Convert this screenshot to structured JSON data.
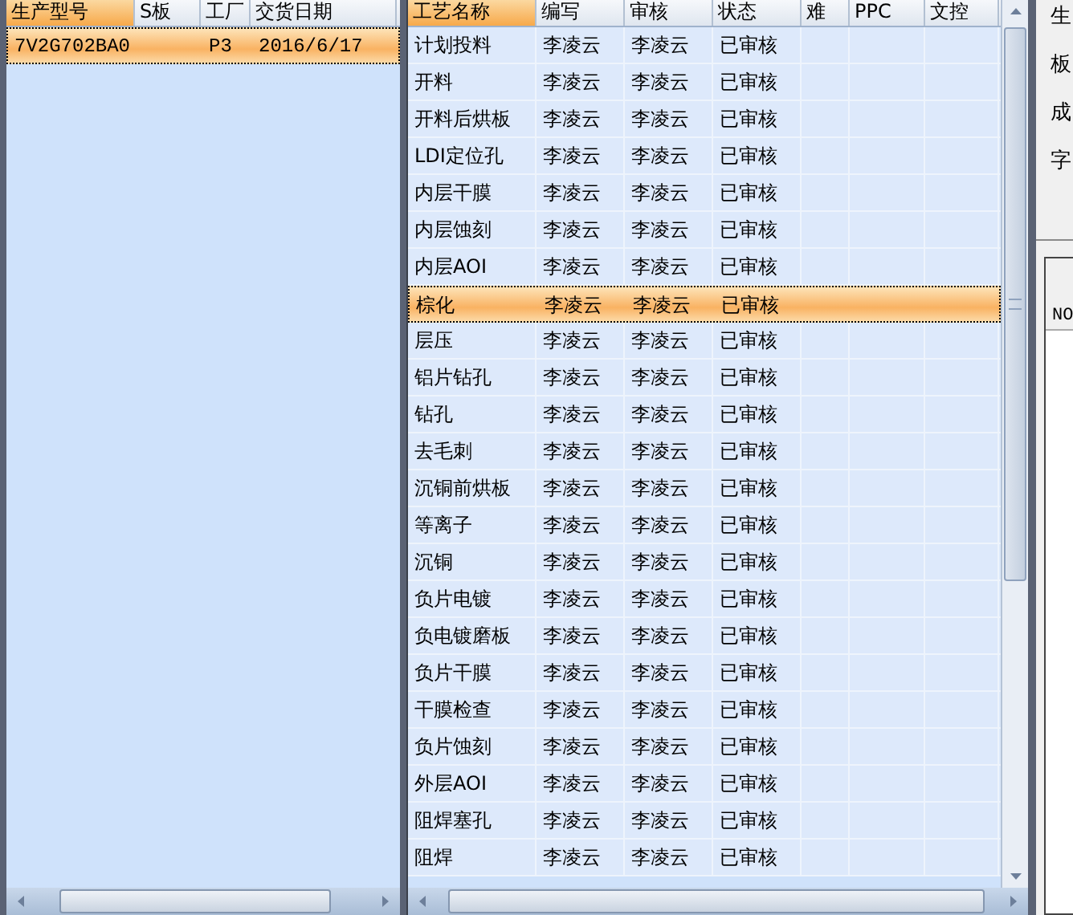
{
  "orders": {
    "columns": [
      {
        "label": "生产型号",
        "selected": true
      },
      {
        "label": "S板",
        "selected": false
      },
      {
        "label": "工厂",
        "selected": false
      },
      {
        "label": "交货日期",
        "selected": false
      }
    ],
    "rows": [
      {
        "cells": [
          "7V2G702BA0",
          "",
          "P3",
          "2016/6/17"
        ],
        "selected": true
      }
    ]
  },
  "processes": {
    "columns": [
      {
        "label": "工艺名称",
        "selected": true
      },
      {
        "label": "编写",
        "selected": false
      },
      {
        "label": "审核",
        "selected": false
      },
      {
        "label": "状态",
        "selected": false
      },
      {
        "label": "难",
        "selected": false
      },
      {
        "label": "PPC",
        "selected": false
      },
      {
        "label": "文控",
        "selected": false
      }
    ],
    "rows": [
      {
        "cells": [
          "计划投料",
          "李凌云",
          "李凌云",
          "已审核",
          "",
          "",
          ""
        ],
        "selected": false
      },
      {
        "cells": [
          "开料",
          "李凌云",
          "李凌云",
          "已审核",
          "",
          "",
          ""
        ],
        "selected": false
      },
      {
        "cells": [
          "开料后烘板",
          "李凌云",
          "李凌云",
          "已审核",
          "",
          "",
          ""
        ],
        "selected": false
      },
      {
        "cells": [
          "LDI定位孔",
          "李凌云",
          "李凌云",
          "已审核",
          "",
          "",
          ""
        ],
        "selected": false
      },
      {
        "cells": [
          "内层干膜",
          "李凌云",
          "李凌云",
          "已审核",
          "",
          "",
          ""
        ],
        "selected": false
      },
      {
        "cells": [
          "内层蚀刻",
          "李凌云",
          "李凌云",
          "已审核",
          "",
          "",
          ""
        ],
        "selected": false
      },
      {
        "cells": [
          "内层AOI",
          "李凌云",
          "李凌云",
          "已审核",
          "",
          "",
          ""
        ],
        "selected": false
      },
      {
        "cells": [
          "棕化",
          "李凌云",
          "李凌云",
          "已审核",
          "",
          "",
          ""
        ],
        "selected": true
      },
      {
        "cells": [
          "层压",
          "李凌云",
          "李凌云",
          "已审核",
          "",
          "",
          ""
        ],
        "selected": false
      },
      {
        "cells": [
          "铝片钻孔",
          "李凌云",
          "李凌云",
          "已审核",
          "",
          "",
          ""
        ],
        "selected": false
      },
      {
        "cells": [
          "钻孔",
          "李凌云",
          "李凌云",
          "已审核",
          "",
          "",
          ""
        ],
        "selected": false
      },
      {
        "cells": [
          "去毛刺",
          "李凌云",
          "李凌云",
          "已审核",
          "",
          "",
          ""
        ],
        "selected": false
      },
      {
        "cells": [
          "沉铜前烘板",
          "李凌云",
          "李凌云",
          "已审核",
          "",
          "",
          ""
        ],
        "selected": false
      },
      {
        "cells": [
          "等离子",
          "李凌云",
          "李凌云",
          "已审核",
          "",
          "",
          ""
        ],
        "selected": false
      },
      {
        "cells": [
          "沉铜",
          "李凌云",
          "李凌云",
          "已审核",
          "",
          "",
          ""
        ],
        "selected": false
      },
      {
        "cells": [
          "负片电镀",
          "李凌云",
          "李凌云",
          "已审核",
          "",
          "",
          ""
        ],
        "selected": false
      },
      {
        "cells": [
          "负电镀磨板",
          "李凌云",
          "李凌云",
          "已审核",
          "",
          "",
          ""
        ],
        "selected": false
      },
      {
        "cells": [
          "负片干膜",
          "李凌云",
          "李凌云",
          "已审核",
          "",
          "",
          ""
        ],
        "selected": false
      },
      {
        "cells": [
          "干膜检查",
          "李凌云",
          "李凌云",
          "已审核",
          "",
          "",
          ""
        ],
        "selected": false
      },
      {
        "cells": [
          "负片蚀刻",
          "李凌云",
          "李凌云",
          "已审核",
          "",
          "",
          ""
        ],
        "selected": false
      },
      {
        "cells": [
          "外层AOI",
          "李凌云",
          "李凌云",
          "已审核",
          "",
          "",
          ""
        ],
        "selected": false
      },
      {
        "cells": [
          "阻焊塞孔",
          "李凌云",
          "李凌云",
          "已审核",
          "",
          "",
          ""
        ],
        "selected": false
      },
      {
        "cells": [
          "阻焊",
          "李凌云",
          "李凌云",
          "已审核",
          "",
          "",
          ""
        ],
        "selected": false
      }
    ]
  },
  "side_panel": {
    "labels": [
      "生",
      "板",
      "成",
      "字"
    ],
    "table_columns": [
      "NO"
    ]
  }
}
